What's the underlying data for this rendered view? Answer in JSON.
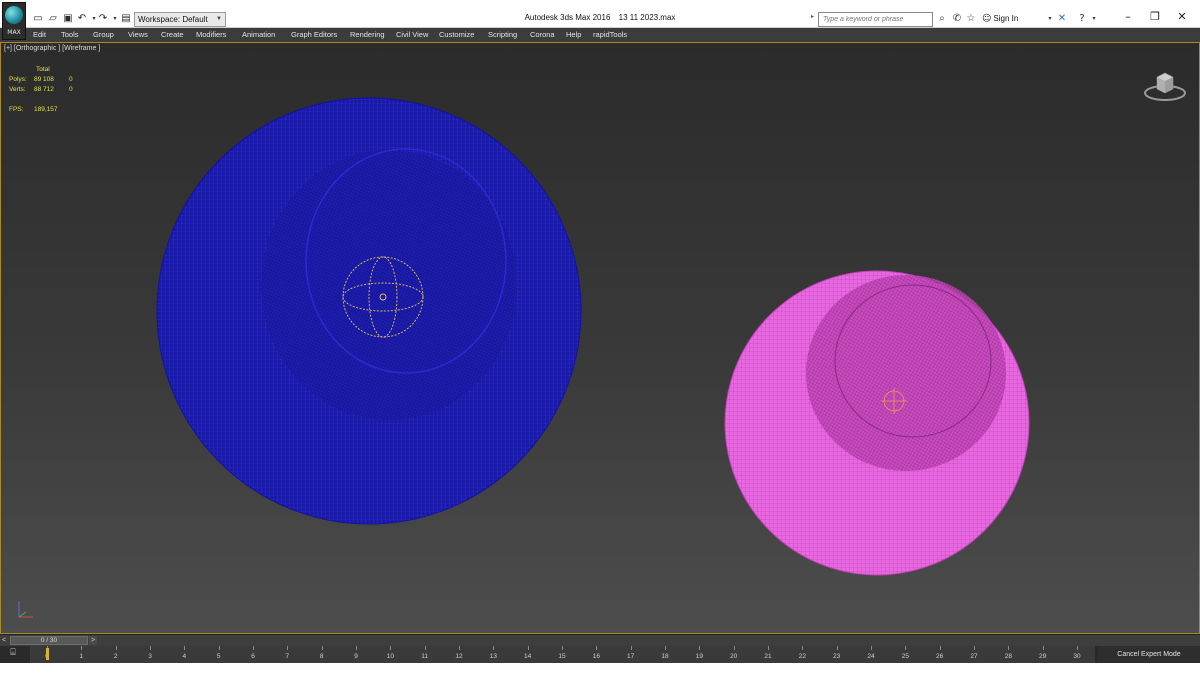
{
  "app": {
    "logo_text": "MAX",
    "window_title": {
      "app_name": "Autodesk 3ds Max 2016",
      "file_name": "13 11 2023.max"
    }
  },
  "quick_access": {
    "workspace_label": "Workspace: Default",
    "icons": [
      "new-file-icon",
      "open-file-icon",
      "save-icon",
      "undo-icon",
      "redo-icon",
      "project-folder-icon"
    ]
  },
  "infocenter": {
    "search_placeholder": "Type a keyword or phrase",
    "signin_label": "Sign In"
  },
  "menu": [
    "Edit",
    "Tools",
    "Group",
    "Views",
    "Create",
    "Modifiers",
    "Animation",
    "Graph Editors",
    "Rendering",
    "Civil View",
    "Customize",
    "Scripting",
    "Corona",
    "Help",
    "rapidTools"
  ],
  "viewport": {
    "label": "[+] [Orthographic ] [Wireframe ]",
    "stats": {
      "header": "Total",
      "polys_label": "Polys:",
      "polys_total": "89 108",
      "polys_sel": "0",
      "verts_label": "Verts:",
      "verts_total": "88 712",
      "verts_sel": "0",
      "fps_label": "FPS:",
      "fps_value": "189,157"
    },
    "colors": {
      "blue_object": "#1f1ec6",
      "pink_object": "#e05ad8",
      "gizmo": "#e6c45a",
      "viewport_border": "#a88a28"
    }
  },
  "timeline": {
    "frame_counter": "0 / 30",
    "prev": "<",
    "next": ">",
    "ticks": [
      "0",
      "1",
      "2",
      "3",
      "4",
      "5",
      "6",
      "7",
      "8",
      "9",
      "10",
      "11",
      "12",
      "13",
      "14",
      "15",
      "16",
      "17",
      "18",
      "19",
      "20",
      "21",
      "22",
      "23",
      "24",
      "25",
      "26",
      "27",
      "28",
      "29",
      "30"
    ],
    "current_frame": 0,
    "cancel_expert_label": "Cancel Expert Mode"
  }
}
